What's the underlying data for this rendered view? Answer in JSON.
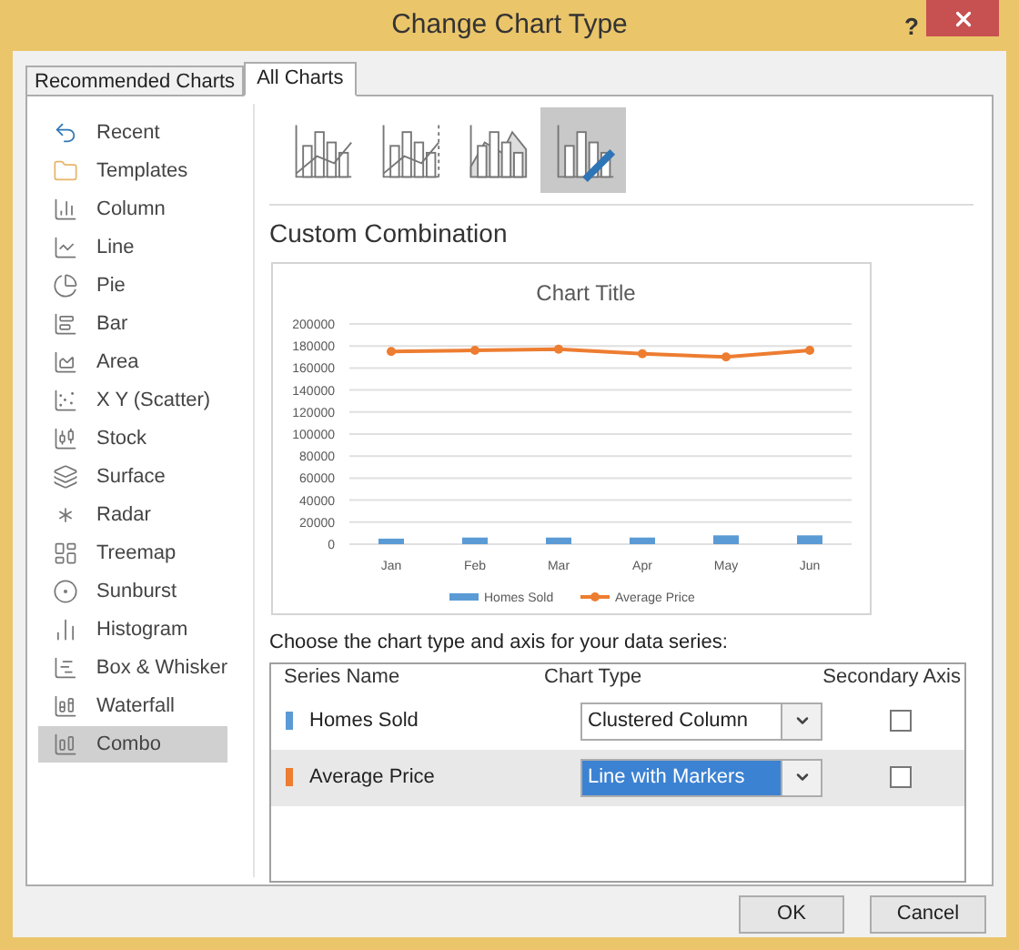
{
  "window": {
    "title": "Change Chart Type",
    "help": "?"
  },
  "tabs": [
    {
      "label": "Recommended Charts",
      "selected": false
    },
    {
      "label": "All Charts",
      "selected": true
    }
  ],
  "sidebar": {
    "items": [
      {
        "label": "Recent",
        "selected": false
      },
      {
        "label": "Templates",
        "selected": false
      },
      {
        "label": "Column",
        "selected": false
      },
      {
        "label": "Line",
        "selected": false
      },
      {
        "label": "Pie",
        "selected": false
      },
      {
        "label": "Bar",
        "selected": false
      },
      {
        "label": "Area",
        "selected": false
      },
      {
        "label": "X Y (Scatter)",
        "selected": false
      },
      {
        "label": "Stock",
        "selected": false
      },
      {
        "label": "Surface",
        "selected": false
      },
      {
        "label": "Radar",
        "selected": false
      },
      {
        "label": "Treemap",
        "selected": false
      },
      {
        "label": "Sunburst",
        "selected": false
      },
      {
        "label": "Histogram",
        "selected": false
      },
      {
        "label": "Box & Whisker",
        "selected": false
      },
      {
        "label": "Waterfall",
        "selected": false
      },
      {
        "label": "Combo",
        "selected": true
      }
    ]
  },
  "subtypes": [
    {
      "selected": false
    },
    {
      "selected": false
    },
    {
      "selected": false
    },
    {
      "selected": true
    }
  ],
  "heading": "Custom Combination",
  "preview": {
    "chart_data": {
      "type": "bar",
      "title": "Chart Title",
      "categories": [
        "Jan",
        "Feb",
        "Mar",
        "Apr",
        "May",
        "Jun"
      ],
      "series": [
        {
          "name": "Homes Sold",
          "color": "#5b9bd5",
          "values": [
            5000,
            6000,
            6000,
            6000,
            8000,
            8000
          ]
        },
        {
          "name": "Average Price",
          "color": "#ed7d31",
          "type": "line",
          "marker": "circle",
          "values": [
            175000,
            176000,
            177000,
            173000,
            170000,
            176000
          ]
        }
      ],
      "stacked": false,
      "grid": true,
      "legend": "bottom",
      "ylim": [
        0,
        200000
      ],
      "yticks": [
        0,
        20000,
        40000,
        60000,
        80000,
        100000,
        120000,
        140000,
        160000,
        180000,
        200000
      ]
    }
  },
  "series_prompt": "Choose the chart type and axis for your data series:",
  "series_table": {
    "columns": [
      "Series Name",
      "Chart Type",
      "Secondary Axis"
    ],
    "rows": [
      {
        "name": "Homes Sold",
        "color": "#5b9bd5",
        "chart_type": "Clustered Column",
        "secondary_axis": false,
        "selected": false
      },
      {
        "name": "Average Price",
        "color": "#ed7d31",
        "chart_type": "Line with Markers",
        "secondary_axis": false,
        "selected": true
      }
    ]
  },
  "buttons": [
    "OK",
    "Cancel"
  ]
}
